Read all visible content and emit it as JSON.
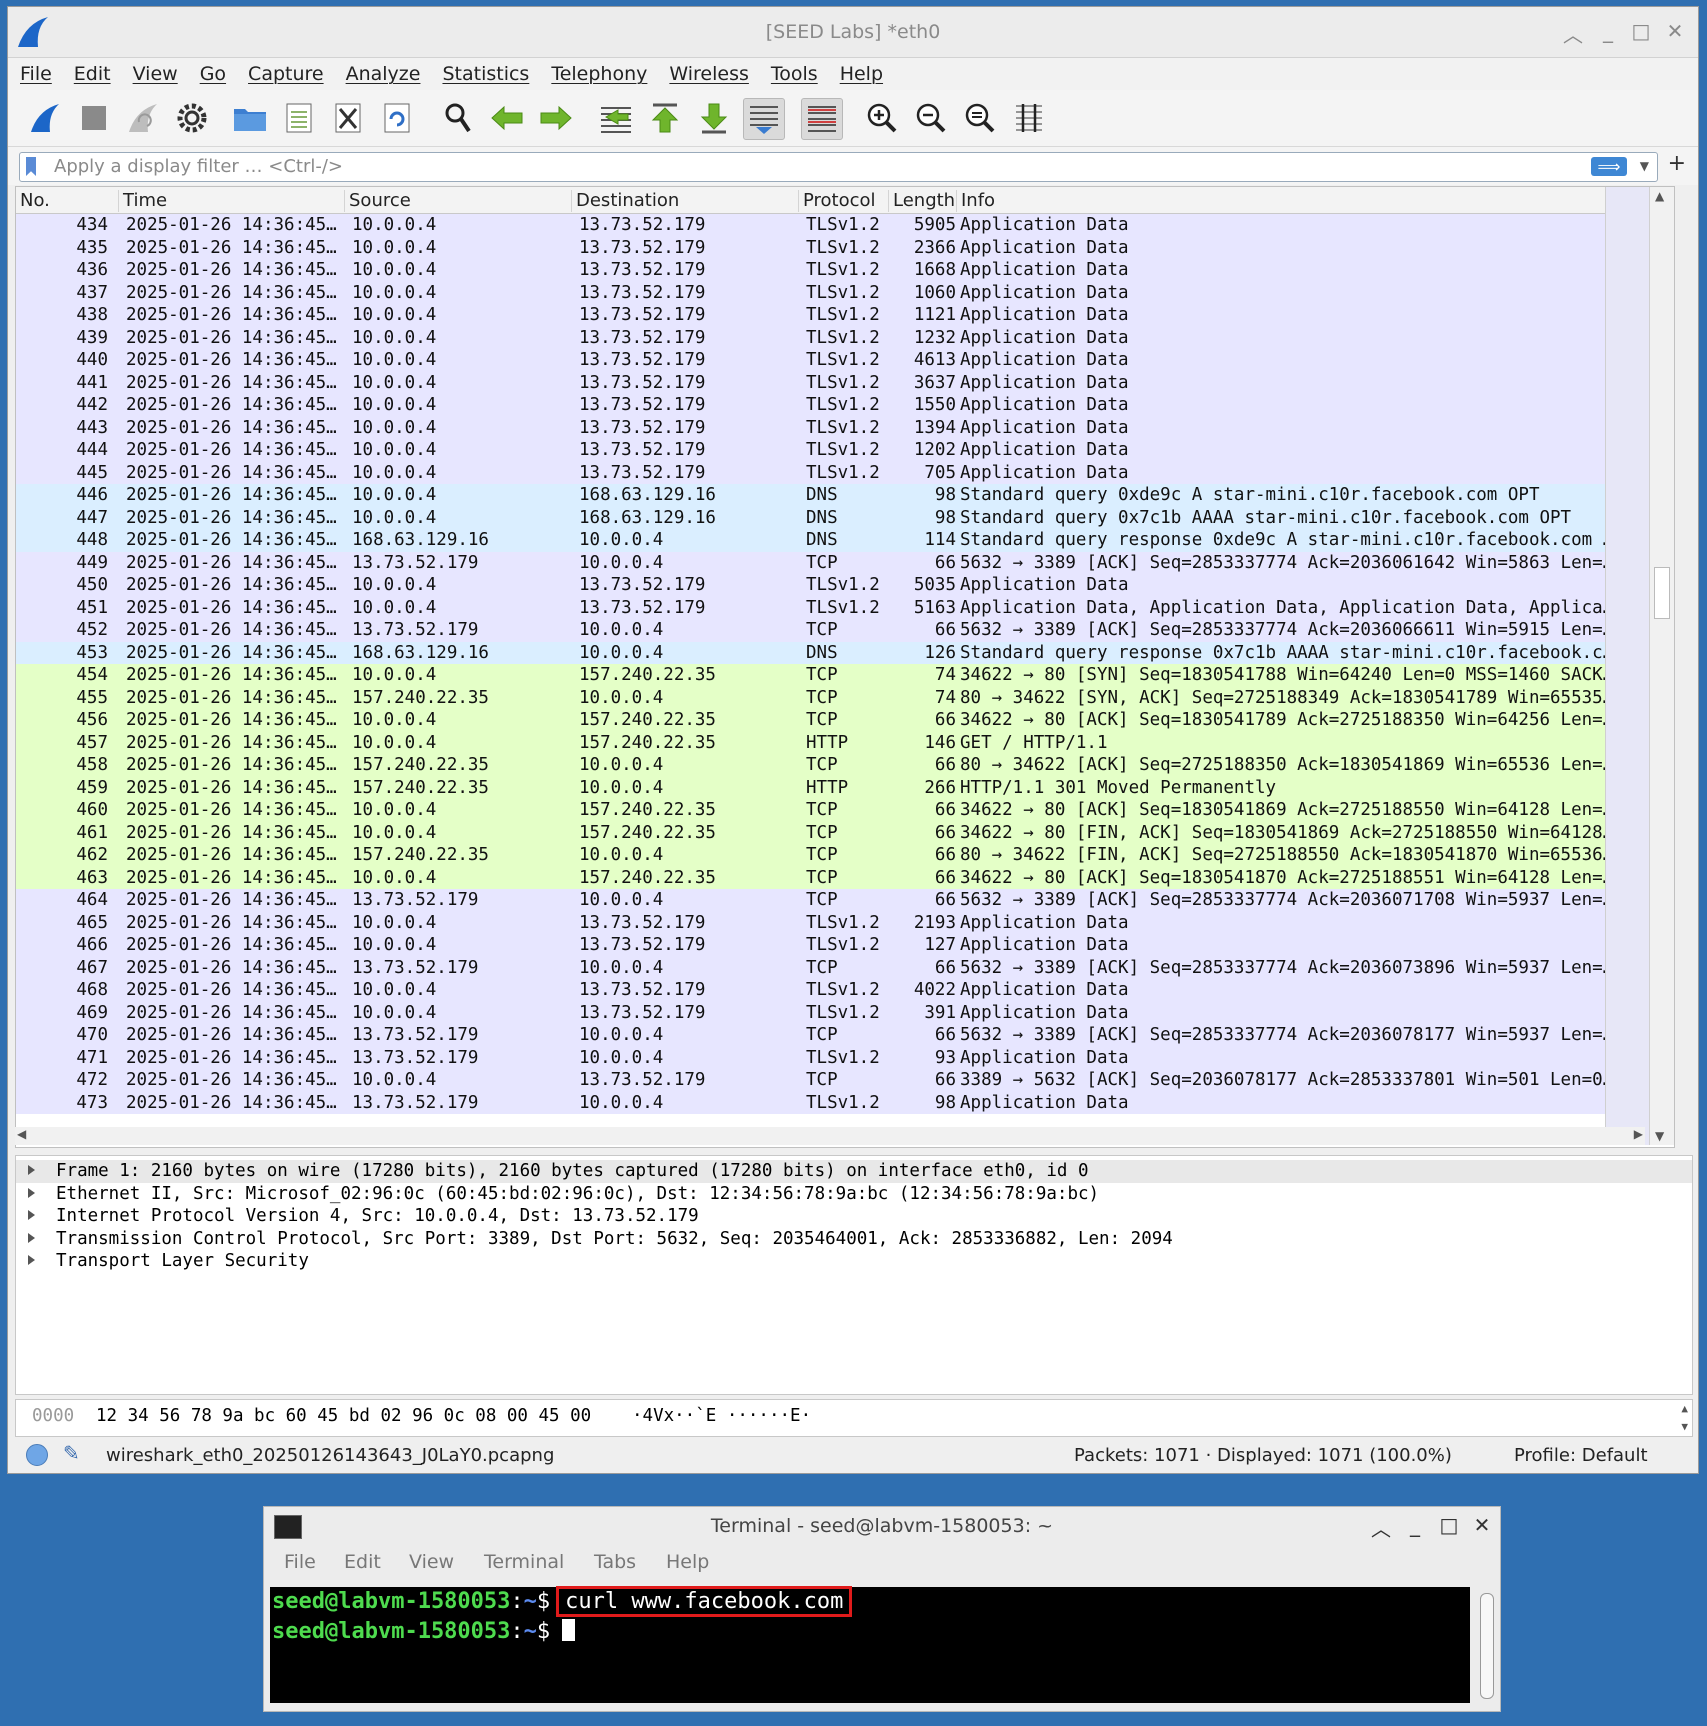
{
  "wireshark": {
    "title": "[SEED Labs] *eth0",
    "menu": [
      "File",
      "Edit",
      "View",
      "Go",
      "Capture",
      "Analyze",
      "Statistics",
      "Telephony",
      "Wireless",
      "Tools",
      "Help"
    ],
    "toolbar_icons": [
      "shark-fin-start-icon",
      "stop-icon",
      "restart-icon",
      "options-gear-icon",
      "open-folder-icon",
      "save-file-icon",
      "close-file-icon",
      "reload-icon",
      "find-icon",
      "back-arrow-icon",
      "forward-arrow-icon",
      "go-to-packet-icon",
      "first-packet-icon",
      "last-packet-icon",
      "autoscroll-icon",
      "colorize-icon",
      "zoom-in-icon",
      "zoom-out-icon",
      "zoom-normal-icon",
      "resize-columns-icon"
    ],
    "filter_placeholder": "Apply a display filter … <Ctrl-/>",
    "filter_apply_glyph": "⟹",
    "filter_add": "+",
    "columns": [
      "No.",
      "Time",
      "Source",
      "Destination",
      "Protocol",
      "Length",
      "Info"
    ],
    "colors": {
      "tls": "#e7e6ff",
      "dns": "#daeeff",
      "http_tcp": "#e4ffc7"
    },
    "packets": [
      {
        "no": "434",
        "time": "2025-01-26 14:36:45…",
        "src": "10.0.0.4",
        "dst": "13.73.52.179",
        "proto": "TLSv1.2",
        "len": "5905",
        "info": "Application Data",
        "color": "tls"
      },
      {
        "no": "435",
        "time": "2025-01-26 14:36:45…",
        "src": "10.0.0.4",
        "dst": "13.73.52.179",
        "proto": "TLSv1.2",
        "len": "2366",
        "info": "Application Data",
        "color": "tls"
      },
      {
        "no": "436",
        "time": "2025-01-26 14:36:45…",
        "src": "10.0.0.4",
        "dst": "13.73.52.179",
        "proto": "TLSv1.2",
        "len": "1668",
        "info": "Application Data",
        "color": "tls"
      },
      {
        "no": "437",
        "time": "2025-01-26 14:36:45…",
        "src": "10.0.0.4",
        "dst": "13.73.52.179",
        "proto": "TLSv1.2",
        "len": "1060",
        "info": "Application Data",
        "color": "tls"
      },
      {
        "no": "438",
        "time": "2025-01-26 14:36:45…",
        "src": "10.0.0.4",
        "dst": "13.73.52.179",
        "proto": "TLSv1.2",
        "len": "1121",
        "info": "Application Data",
        "color": "tls"
      },
      {
        "no": "439",
        "time": "2025-01-26 14:36:45…",
        "src": "10.0.0.4",
        "dst": "13.73.52.179",
        "proto": "TLSv1.2",
        "len": "1232",
        "info": "Application Data",
        "color": "tls"
      },
      {
        "no": "440",
        "time": "2025-01-26 14:36:45…",
        "src": "10.0.0.4",
        "dst": "13.73.52.179",
        "proto": "TLSv1.2",
        "len": "4613",
        "info": "Application Data",
        "color": "tls"
      },
      {
        "no": "441",
        "time": "2025-01-26 14:36:45…",
        "src": "10.0.0.4",
        "dst": "13.73.52.179",
        "proto": "TLSv1.2",
        "len": "3637",
        "info": "Application Data",
        "color": "tls"
      },
      {
        "no": "442",
        "time": "2025-01-26 14:36:45…",
        "src": "10.0.0.4",
        "dst": "13.73.52.179",
        "proto": "TLSv1.2",
        "len": "1550",
        "info": "Application Data",
        "color": "tls"
      },
      {
        "no": "443",
        "time": "2025-01-26 14:36:45…",
        "src": "10.0.0.4",
        "dst": "13.73.52.179",
        "proto": "TLSv1.2",
        "len": "1394",
        "info": "Application Data",
        "color": "tls"
      },
      {
        "no": "444",
        "time": "2025-01-26 14:36:45…",
        "src": "10.0.0.4",
        "dst": "13.73.52.179",
        "proto": "TLSv1.2",
        "len": "1202",
        "info": "Application Data",
        "color": "tls"
      },
      {
        "no": "445",
        "time": "2025-01-26 14:36:45…",
        "src": "10.0.0.4",
        "dst": "13.73.52.179",
        "proto": "TLSv1.2",
        "len": "705",
        "info": "Application Data",
        "color": "tls"
      },
      {
        "no": "446",
        "time": "2025-01-26 14:36:45…",
        "src": "10.0.0.4",
        "dst": "168.63.129.16",
        "proto": "DNS",
        "len": "98",
        "info": "Standard query 0xde9c A star-mini.c10r.facebook.com OPT",
        "color": "dns"
      },
      {
        "no": "447",
        "time": "2025-01-26 14:36:45…",
        "src": "10.0.0.4",
        "dst": "168.63.129.16",
        "proto": "DNS",
        "len": "98",
        "info": "Standard query 0x7c1b AAAA star-mini.c10r.facebook.com OPT",
        "color": "dns"
      },
      {
        "no": "448",
        "time": "2025-01-26 14:36:45…",
        "src": "168.63.129.16",
        "dst": "10.0.0.4",
        "proto": "DNS",
        "len": "114",
        "info": "Standard query response 0xde9c A star-mini.c10r.facebook.com …",
        "color": "dns"
      },
      {
        "no": "449",
        "time": "2025-01-26 14:36:45…",
        "src": "13.73.52.179",
        "dst": "10.0.0.4",
        "proto": "TCP",
        "len": "66",
        "info": "5632 → 3389 [ACK] Seq=2853337774 Ack=2036061642 Win=5863 Len=…",
        "color": "tls"
      },
      {
        "no": "450",
        "time": "2025-01-26 14:36:45…",
        "src": "10.0.0.4",
        "dst": "13.73.52.179",
        "proto": "TLSv1.2",
        "len": "5035",
        "info": "Application Data",
        "color": "tls"
      },
      {
        "no": "451",
        "time": "2025-01-26 14:36:45…",
        "src": "10.0.0.4",
        "dst": "13.73.52.179",
        "proto": "TLSv1.2",
        "len": "5163",
        "info": "Application Data, Application Data, Application Data, Applica…",
        "color": "tls"
      },
      {
        "no": "452",
        "time": "2025-01-26 14:36:45…",
        "src": "13.73.52.179",
        "dst": "10.0.0.4",
        "proto": "TCP",
        "len": "66",
        "info": "5632 → 3389 [ACK] Seq=2853337774 Ack=2036066611 Win=5915 Len=…",
        "color": "tls"
      },
      {
        "no": "453",
        "time": "2025-01-26 14:36:45…",
        "src": "168.63.129.16",
        "dst": "10.0.0.4",
        "proto": "DNS",
        "len": "126",
        "info": "Standard query response 0x7c1b AAAA star-mini.c10r.facebook.c…",
        "color": "dns"
      },
      {
        "no": "454",
        "time": "2025-01-26 14:36:45…",
        "src": "10.0.0.4",
        "dst": "157.240.22.35",
        "proto": "TCP",
        "len": "74",
        "info": "34622 → 80 [SYN] Seq=1830541788 Win=64240 Len=0 MSS=1460 SACK…",
        "color": "http_tcp"
      },
      {
        "no": "455",
        "time": "2025-01-26 14:36:45…",
        "src": "157.240.22.35",
        "dst": "10.0.0.4",
        "proto": "TCP",
        "len": "74",
        "info": "80 → 34622 [SYN, ACK] Seq=2725188349 Ack=1830541789 Win=65535…",
        "color": "http_tcp"
      },
      {
        "no": "456",
        "time": "2025-01-26 14:36:45…",
        "src": "10.0.0.4",
        "dst": "157.240.22.35",
        "proto": "TCP",
        "len": "66",
        "info": "34622 → 80 [ACK] Seq=1830541789 Ack=2725188350 Win=64256 Len=…",
        "color": "http_tcp"
      },
      {
        "no": "457",
        "time": "2025-01-26 14:36:45…",
        "src": "10.0.0.4",
        "dst": "157.240.22.35",
        "proto": "HTTP",
        "len": "146",
        "info": "GET / HTTP/1.1",
        "color": "http_tcp"
      },
      {
        "no": "458",
        "time": "2025-01-26 14:36:45…",
        "src": "157.240.22.35",
        "dst": "10.0.0.4",
        "proto": "TCP",
        "len": "66",
        "info": "80 → 34622 [ACK] Seq=2725188350 Ack=1830541869 Win=65536 Len=…",
        "color": "http_tcp"
      },
      {
        "no": "459",
        "time": "2025-01-26 14:36:45…",
        "src": "157.240.22.35",
        "dst": "10.0.0.4",
        "proto": "HTTP",
        "len": "266",
        "info": "HTTP/1.1 301 Moved Permanently",
        "color": "http_tcp"
      },
      {
        "no": "460",
        "time": "2025-01-26 14:36:45…",
        "src": "10.0.0.4",
        "dst": "157.240.22.35",
        "proto": "TCP",
        "len": "66",
        "info": "34622 → 80 [ACK] Seq=1830541869 Ack=2725188550 Win=64128 Len=…",
        "color": "http_tcp"
      },
      {
        "no": "461",
        "time": "2025-01-26 14:36:45…",
        "src": "10.0.0.4",
        "dst": "157.240.22.35",
        "proto": "TCP",
        "len": "66",
        "info": "34622 → 80 [FIN, ACK] Seq=1830541869 Ack=2725188550 Win=64128…",
        "color": "http_tcp"
      },
      {
        "no": "462",
        "time": "2025-01-26 14:36:45…",
        "src": "157.240.22.35",
        "dst": "10.0.0.4",
        "proto": "TCP",
        "len": "66",
        "info": "80 → 34622 [FIN, ACK] Seq=2725188550 Ack=1830541870 Win=65536…",
        "color": "http_tcp"
      },
      {
        "no": "463",
        "time": "2025-01-26 14:36:45…",
        "src": "10.0.0.4",
        "dst": "157.240.22.35",
        "proto": "TCP",
        "len": "66",
        "info": "34622 → 80 [ACK] Seq=1830541870 Ack=2725188551 Win=64128 Len=…",
        "color": "http_tcp"
      },
      {
        "no": "464",
        "time": "2025-01-26 14:36:45…",
        "src": "13.73.52.179",
        "dst": "10.0.0.4",
        "proto": "TCP",
        "len": "66",
        "info": "5632 → 3389 [ACK] Seq=2853337774 Ack=2036071708 Win=5937 Len=…",
        "color": "tls"
      },
      {
        "no": "465",
        "time": "2025-01-26 14:36:45…",
        "src": "10.0.0.4",
        "dst": "13.73.52.179",
        "proto": "TLSv1.2",
        "len": "2193",
        "info": "Application Data",
        "color": "tls"
      },
      {
        "no": "466",
        "time": "2025-01-26 14:36:45…",
        "src": "10.0.0.4",
        "dst": "13.73.52.179",
        "proto": "TLSv1.2",
        "len": "127",
        "info": "Application Data",
        "color": "tls"
      },
      {
        "no": "467",
        "time": "2025-01-26 14:36:45…",
        "src": "13.73.52.179",
        "dst": "10.0.0.4",
        "proto": "TCP",
        "len": "66",
        "info": "5632 → 3389 [ACK] Seq=2853337774 Ack=2036073896 Win=5937 Len=…",
        "color": "tls"
      },
      {
        "no": "468",
        "time": "2025-01-26 14:36:45…",
        "src": "10.0.0.4",
        "dst": "13.73.52.179",
        "proto": "TLSv1.2",
        "len": "4022",
        "info": "Application Data",
        "color": "tls"
      },
      {
        "no": "469",
        "time": "2025-01-26 14:36:45…",
        "src": "10.0.0.4",
        "dst": "13.73.52.179",
        "proto": "TLSv1.2",
        "len": "391",
        "info": "Application Data",
        "color": "tls"
      },
      {
        "no": "470",
        "time": "2025-01-26 14:36:45…",
        "src": "13.73.52.179",
        "dst": "10.0.0.4",
        "proto": "TCP",
        "len": "66",
        "info": "5632 → 3389 [ACK] Seq=2853337774 Ack=2036078177 Win=5937 Len=…",
        "color": "tls"
      },
      {
        "no": "471",
        "time": "2025-01-26 14:36:45…",
        "src": "13.73.52.179",
        "dst": "10.0.0.4",
        "proto": "TLSv1.2",
        "len": "93",
        "info": "Application Data",
        "color": "tls"
      },
      {
        "no": "472",
        "time": "2025-01-26 14:36:45…",
        "src": "10.0.0.4",
        "dst": "13.73.52.179",
        "proto": "TCP",
        "len": "66",
        "info": "3389 → 5632 [ACK] Seq=2036078177 Ack=2853337801 Win=501 Len=0…",
        "color": "tls"
      },
      {
        "no": "473",
        "time": "2025-01-26 14:36:45…",
        "src": "13.73.52.179",
        "dst": "10.0.0.4",
        "proto": "TLSv1.2",
        "len": "98",
        "info": "Application Data",
        "color": "tls"
      }
    ],
    "details": [
      "Frame 1: 2160 bytes on wire (17280 bits), 2160 bytes captured (17280 bits) on interface eth0, id 0",
      "Ethernet II, Src: Microsof_02:96:0c (60:45:bd:02:96:0c), Dst: 12:34:56:78:9a:bc (12:34:56:78:9a:bc)",
      "Internet Protocol Version 4, Src: 10.0.0.4, Dst: 13.73.52.179",
      "Transmission Control Protocol, Src Port: 3389, Dst Port: 5632, Seq: 2035464001, Ack: 2853336882, Len: 2094",
      "Transport Layer Security"
    ],
    "bytes": {
      "offset": "0000",
      "hex": "12 34 56 78 9a bc 60 45  bd 02 96 0c 08 00 45 00",
      "ascii": "·4Vx··`E ······E·"
    },
    "status": {
      "file": "wireshark_eth0_20250126143643_J0LaY0.pcapng",
      "packets": "Packets: 1071 · Displayed: 1071 (100.0%)",
      "profile": "Profile: Default"
    }
  },
  "terminal": {
    "title": "Terminal - seed@labvm-1580053: ~",
    "menu": [
      "File",
      "Edit",
      "View",
      "Terminal",
      "Tabs",
      "Help"
    ],
    "prompt_user": "seed@labvm-1580053",
    "prompt_sep": ":",
    "prompt_path": "~",
    "prompt_dollar": "$",
    "command": "curl www.facebook.com",
    "highlight_color": "#e01b1b"
  }
}
